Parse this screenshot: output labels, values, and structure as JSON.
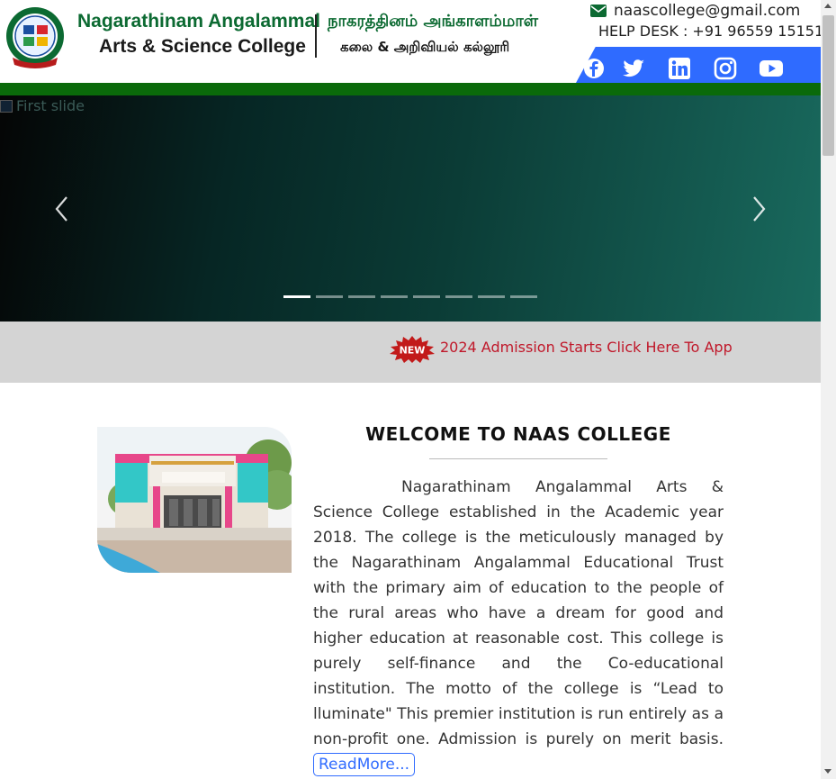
{
  "header": {
    "college_name_en_line1": "Nagarathinam Angalammal",
    "college_name_en_line2": "Arts & Science College",
    "college_name_ta_line1": "நாகரத்தினம் அங்காளம்மாள்",
    "college_name_ta_line2": "கலை & அறிவியல் கல்லூரி",
    "logo_icon": "college-crest-icon",
    "logo_motto": "Lead to Illuminate"
  },
  "contact": {
    "email_icon": "envelope-icon",
    "email": "naascollege@gmail.com",
    "help_desk": "HELP DESK : +91 96559 15151"
  },
  "social": {
    "bar_color": "#2f6bff",
    "icons": [
      "facebook-icon",
      "twitter-icon",
      "linkedin-icon",
      "instagram-icon",
      "youtube-icon"
    ]
  },
  "slider": {
    "broken_image_alt": "First slide",
    "prev_icon": "chevron-left-icon",
    "next_icon": "chevron-right-icon",
    "slide_count": 8,
    "active_index": 0
  },
  "marquee": {
    "badge_label": "NEW",
    "text": "2024 Admission Starts Click Here To App",
    "text_color": "#c0182a"
  },
  "welcome": {
    "title": "WELCOME TO NAAS COLLEGE",
    "body": "Nagarathinam Angalammal Arts & Science College established in the Academic year 2018. The college is the meticulously managed by the Nagarathinam Angalammal Educational Trust with the primary aim of education to the people of the rural areas who have a dream for good and higher education at reasonable cost. This college is purely self-finance and the Co-educational institution. The motto of the college is “Lead to lluminate\" This premier institution is run entirely as a non-profit one. Admission is purely on merit basis.",
    "read_more": "ReadMore..."
  },
  "colors": {
    "brand_green": "#0c6a32",
    "strip_green": "#0a6a0a",
    "link_blue": "#2f6bff"
  }
}
